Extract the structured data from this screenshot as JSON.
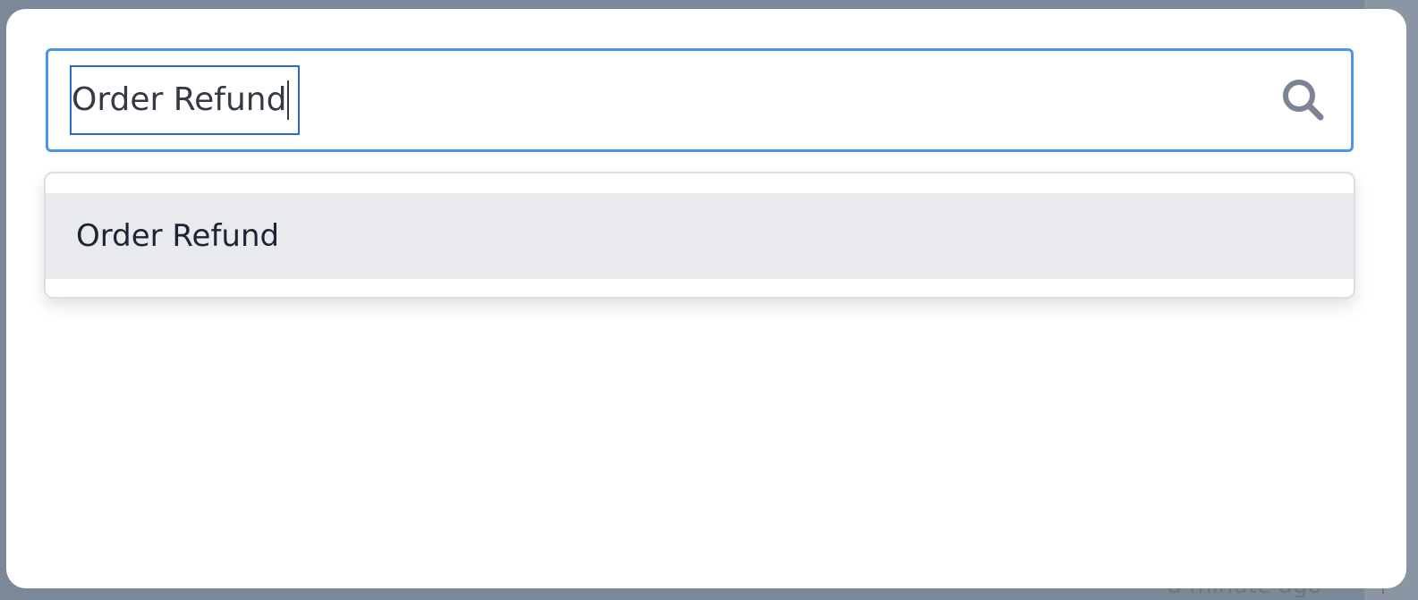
{
  "search": {
    "value": "Order Refund",
    "icon": "search-icon"
  },
  "results": [
    {
      "label": "Order Refund"
    }
  ],
  "background": {
    "peek_text": "a minute ago"
  },
  "colors": {
    "overlay": "#7b8898",
    "focus_border": "#4d94f0",
    "highlight_row": "#e9eaee",
    "icon": "#7a8494"
  }
}
